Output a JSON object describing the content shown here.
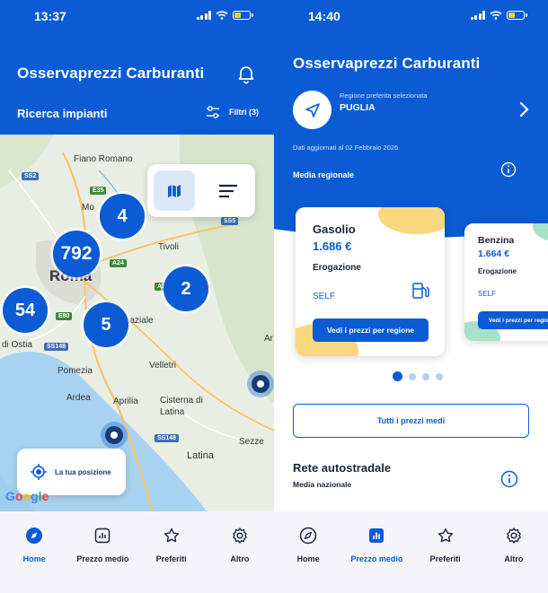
{
  "left": {
    "status_time": "13:37",
    "app_title": "Osservaprezzi Carburanti",
    "search_label": "Ricerca impianti",
    "filters_label": "Filtri (3)",
    "map": {
      "labels": [
        "Fiano Romano",
        "Mo",
        "Tivoli",
        "Roma",
        "Albano Laziale",
        "di Ostia",
        "Pomezia",
        "Velletri",
        "Ardea",
        "Aprilia",
        "Cisterna di Latina",
        "Sezze",
        "Latina",
        "Ar"
      ],
      "road_badges": [
        "SS2",
        "E35",
        "A24",
        "SS5",
        "A1",
        "E80",
        "SS148",
        "SS148"
      ],
      "clusters": [
        "4",
        "792",
        "2",
        "54",
        "5"
      ],
      "locate_label": "La tua posizione",
      "attribution": "Google"
    },
    "nav": [
      {
        "label": "Home",
        "icon": "compass-icon",
        "active": true
      },
      {
        "label": "Prezzo medio",
        "icon": "chart-icon",
        "active": false
      },
      {
        "label": "Preferiti",
        "icon": "star-icon",
        "active": false
      },
      {
        "label": "Altro",
        "icon": "gear-icon",
        "active": false
      }
    ]
  },
  "right": {
    "status_time": "14:40",
    "app_title": "Osservaprezzi Carburanti",
    "region_caption": "Regione preferita selezionata",
    "region_name": "PUGLIA",
    "updated_text": "Dati aggiornati al 02 Febbraio 2026",
    "media_regionale": "Media regionale",
    "cards": [
      {
        "fuel": "Gasolio",
        "price": "1.686 €",
        "erogazione": "Erogazione",
        "mode": "SELF",
        "button": "Vedi i prezzi per regione"
      },
      {
        "fuel": "Benzina",
        "price": "1.664 €",
        "erogazione": "Erogazione",
        "mode": "SELF",
        "button": "Vedi i prezzi per regione"
      }
    ],
    "carousel_page": 1,
    "carousel_total": 4,
    "all_prices_button": "Tutti i prezzi medi",
    "rete_title": "Rete autostradale",
    "rete_sub": "Media nazionale",
    "nav": [
      {
        "label": "Home",
        "icon": "compass-icon",
        "active": false
      },
      {
        "label": "Prezzo medio",
        "icon": "chart-icon",
        "active": true
      },
      {
        "label": "Preferiti",
        "icon": "star-icon",
        "active": false
      },
      {
        "label": "Altro",
        "icon": "gear-icon",
        "active": false
      }
    ]
  },
  "colors": {
    "brand_blue": "#0a5bd4",
    "nav_bg": "#f6f4fb",
    "card_yellow": "#f8d77f",
    "card_green": "#a8e0c8"
  }
}
